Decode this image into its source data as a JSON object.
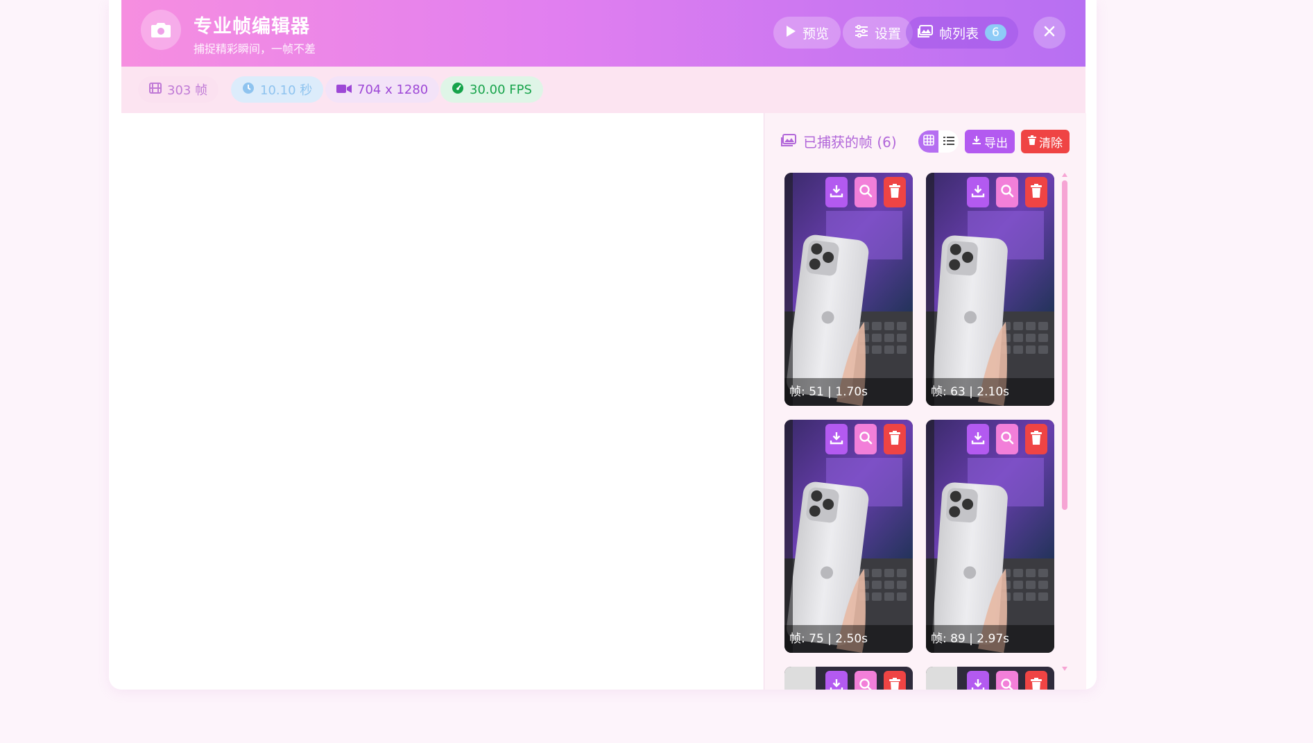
{
  "header": {
    "title": "专业帧编辑器",
    "subtitle": "捕捉精彩瞬间，一帧不差",
    "buttons": {
      "preview": "预览",
      "settings": "设置",
      "frame_list": "帧列表",
      "frame_list_count": "6"
    }
  },
  "stats": {
    "frames": "303 帧",
    "duration": "10.10 秒",
    "resolution": "704 x 1280",
    "fps": "30.00 FPS"
  },
  "panel": {
    "title": "已捕获的帧 (6)",
    "export_label": "导出",
    "clear_label": "清除",
    "view_mode": "grid"
  },
  "frames": [
    {
      "caption": "帧: 51 | 1.70s"
    },
    {
      "caption": "帧: 63 | 2.10s"
    },
    {
      "caption": "帧: 75 | 2.50s"
    },
    {
      "caption": "帧: 89 | 2.97s"
    }
  ],
  "icons": [
    "camera-icon",
    "play-icon",
    "sliders-icon",
    "images-icon",
    "close-icon",
    "film-icon",
    "clock-icon",
    "video-icon",
    "gauge-icon",
    "grid-icon",
    "list-icon",
    "download-icon",
    "trash-icon",
    "search-icon"
  ],
  "colors": {
    "header_start": "#f68ee0",
    "header_end": "#b76ff2",
    "accent_purple": "#b35af0",
    "accent_pink": "#f27fd9",
    "danger": "#ef4444",
    "fps_green": "#16a34a"
  }
}
